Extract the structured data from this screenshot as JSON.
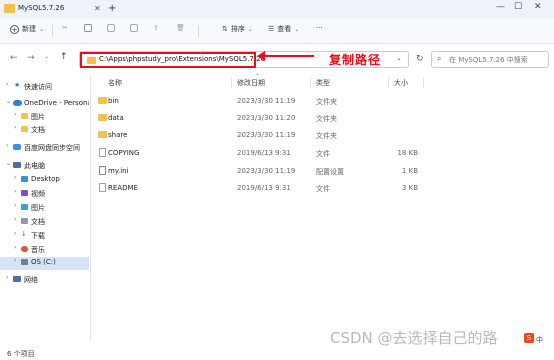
{
  "window": {
    "title": "MySQL5.7.26"
  },
  "toolbar": {
    "new_label": "新建",
    "sort_label": "排序",
    "view_label": "查看",
    "more_label": "···"
  },
  "address": {
    "path": "C:\\Apps\\phpstudy_pro\\Extensions\\MySQL5.7.26",
    "callout": "复制路径",
    "search_placeholder": "在 MySQL5.7.26 中搜索"
  },
  "sidebar": {
    "items": [
      {
        "label": "快速访问",
        "indent": 0,
        "icon": "star",
        "expandable": true,
        "expanded": false
      },
      {
        "label": "OneDrive - Persona",
        "indent": 0,
        "icon": "cloud",
        "expandable": true,
        "expanded": true
      },
      {
        "label": "图片",
        "indent": 1,
        "icon": "folder",
        "expandable": true,
        "expanded": false
      },
      {
        "label": "文档",
        "indent": 1,
        "icon": "folder",
        "expandable": true,
        "expanded": false
      },
      {
        "label": "百度网盘同步空间",
        "indent": 0,
        "icon": "baidu",
        "expandable": true,
        "expanded": false
      },
      {
        "label": "此电脑",
        "indent": 0,
        "icon": "pc",
        "expandable": true,
        "expanded": true
      },
      {
        "label": "Desktop",
        "indent": 1,
        "icon": "desktop",
        "expandable": true,
        "expanded": false
      },
      {
        "label": "视频",
        "indent": 1,
        "icon": "video",
        "expandable": true,
        "expanded": false
      },
      {
        "label": "图片",
        "indent": 1,
        "icon": "pictures",
        "expandable": true,
        "expanded": false
      },
      {
        "label": "文档",
        "indent": 1,
        "icon": "documents",
        "expandable": true,
        "expanded": false
      },
      {
        "label": "下载",
        "indent": 1,
        "icon": "download",
        "expandable": true,
        "expanded": false
      },
      {
        "label": "音乐",
        "indent": 1,
        "icon": "music",
        "expandable": true,
        "expanded": false
      },
      {
        "label": "OS (C:)",
        "indent": 1,
        "icon": "drive",
        "expandable": true,
        "expanded": false,
        "selected": true
      },
      {
        "label": "网络",
        "indent": 0,
        "icon": "network",
        "expandable": true,
        "expanded": false
      }
    ]
  },
  "columns": {
    "name": "名称",
    "date": "修改日期",
    "type": "类型",
    "size": "大小"
  },
  "files": [
    {
      "name": "bin",
      "date": "2023/3/30 11:19",
      "type": "文件夹",
      "size": "",
      "kind": "folder"
    },
    {
      "name": "data",
      "date": "2023/3/30 11:20",
      "type": "文件夹",
      "size": "",
      "kind": "folder"
    },
    {
      "name": "share",
      "date": "2023/3/30 11:19",
      "type": "文件夹",
      "size": "",
      "kind": "folder"
    },
    {
      "name": "COPYING",
      "date": "2019/6/13 9:31",
      "type": "文件",
      "size": "18 KB",
      "kind": "file"
    },
    {
      "name": "my.ini",
      "date": "2023/3/30 11:19",
      "type": "配置设置",
      "size": "1 KB",
      "kind": "ini"
    },
    {
      "name": "README",
      "date": "2019/6/13 9:31",
      "type": "文件",
      "size": "3 KB",
      "kind": "file"
    }
  ],
  "status": {
    "count": "6 个项目"
  },
  "watermark": "CSDN @去选择自己的路",
  "csdn_badge": {
    "logo": "S",
    "lang": "中"
  },
  "colors": {
    "accent": "#e5101b",
    "folder": "#f0c34e",
    "selection": "#d6e5f6"
  }
}
